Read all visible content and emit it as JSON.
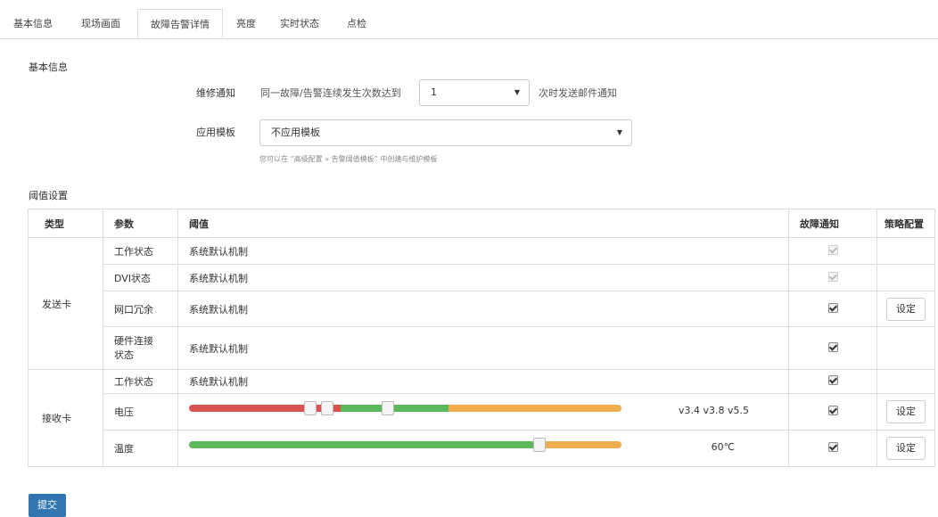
{
  "tabs": [
    {
      "label": "基本信息"
    },
    {
      "label": "现场画面"
    },
    {
      "label": "故障告警详情"
    },
    {
      "label": "亮度"
    },
    {
      "label": "实时状态"
    },
    {
      "label": "点检"
    }
  ],
  "active_tab": "故障告警详情",
  "basic": {
    "title": "基本信息",
    "repair_label": "维修通知",
    "repair_prefix": "同一故障/告警连续发生次数达到",
    "repair_value": "1",
    "repair_suffix": "次时发送邮件通知",
    "template_label": "应用模板",
    "template_value": "不应用模板",
    "template_hint": "您可以在 “高级配置 » 告警阈值模板” 中创建与维护模板"
  },
  "threshold": {
    "title": "阈值设置",
    "headers": {
      "type": "类型",
      "param": "参数",
      "value": "阈值",
      "notify": "故障通知",
      "strategy": "策略配置"
    },
    "send_card": "发送卡",
    "recv_card": "接收卡",
    "rows": [
      {
        "param": "工作状态",
        "value": "系统默认机制",
        "notify_disabled": true
      },
      {
        "param": "DVI状态",
        "value": "系统默认机制",
        "notify_disabled": true
      },
      {
        "param": "网口冗余",
        "value": "系统默认机制",
        "notify_disabled": false,
        "has_button": true
      },
      {
        "param": "硬件连接状态",
        "value": "系统默认机制",
        "notify_disabled": false
      },
      {
        "param": "工作状态",
        "value": "系统默认机制",
        "notify_disabled": false
      },
      {
        "param": "电压",
        "readout": "v3.4  v3.8  v5.5",
        "notify_disabled": false,
        "has_button": true
      },
      {
        "param": "温度",
        "readout": "60℃",
        "notify_disabled": false,
        "has_button": true
      }
    ],
    "voltage_levels": [
      3.4,
      3.8,
      5.5
    ],
    "temperature_level": 60,
    "set_label": "设定"
  },
  "colors": {
    "red": "#d9534f",
    "green": "#5cb85c",
    "orange": "#f0ad4e",
    "primary": "#3276b1"
  },
  "submit_label": "提交"
}
